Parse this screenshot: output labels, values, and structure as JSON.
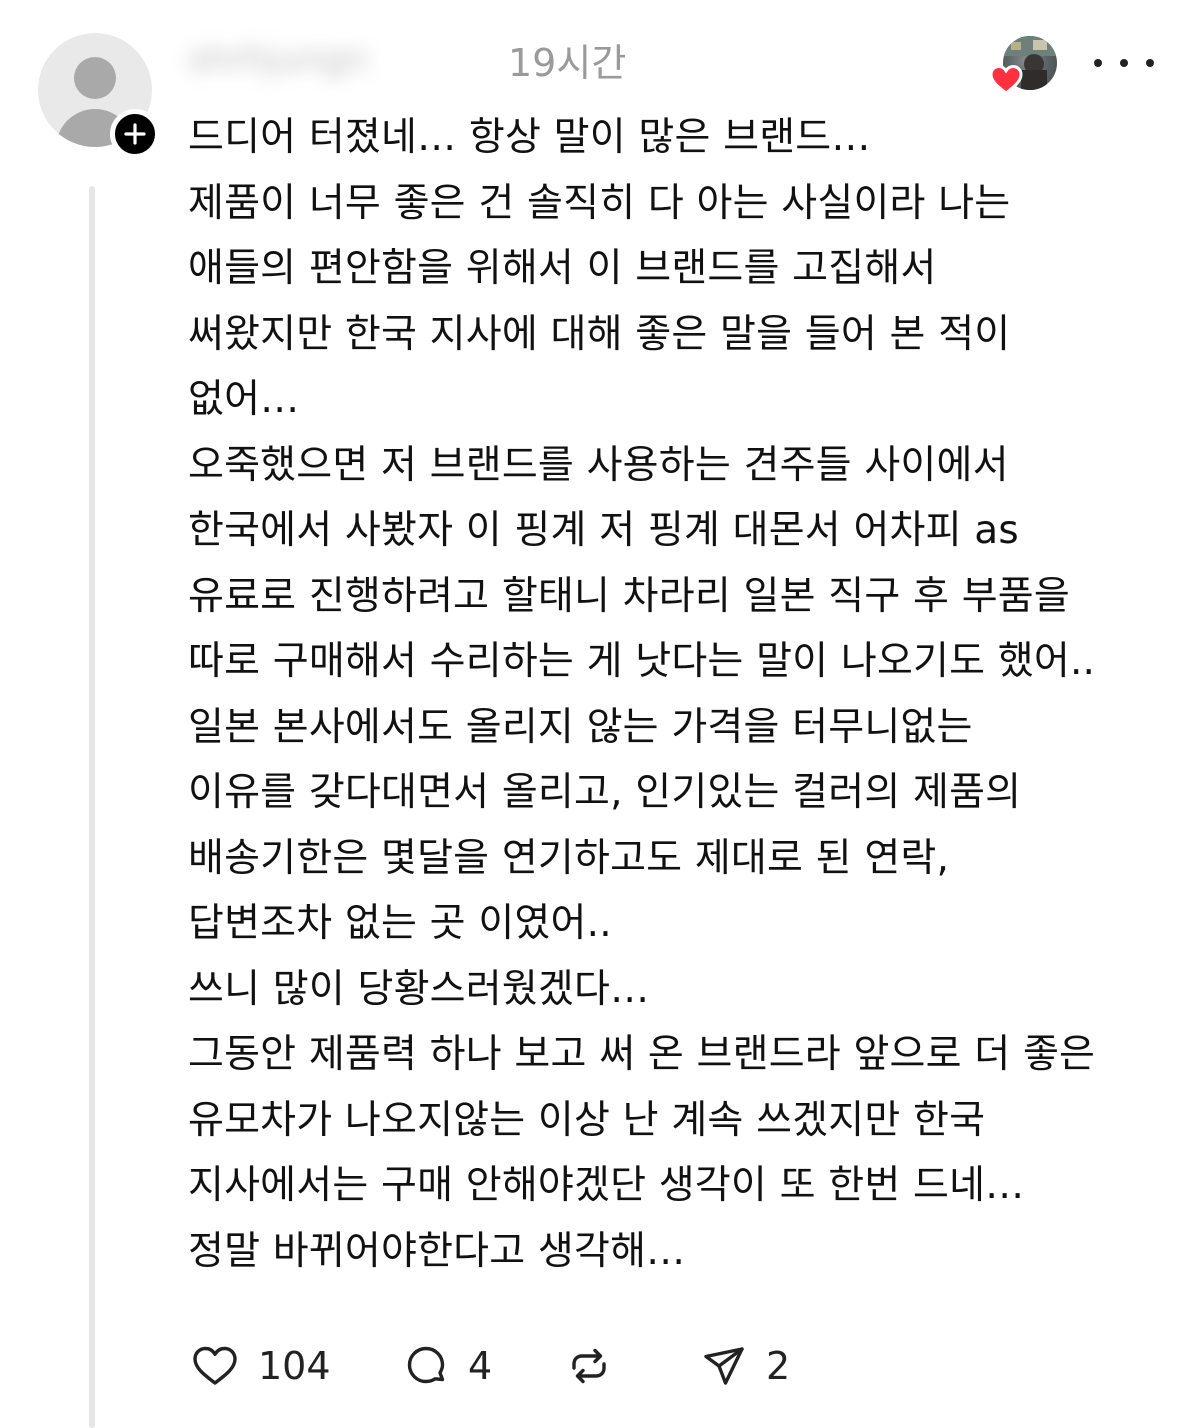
{
  "post": {
    "username": "shrhjungn",
    "timestamp": "19시간",
    "body_lines": [
      "드디어 터졌네… 항상 말이 많은 브랜드…",
      "제품이 너무 좋은 건 솔직히 다 아는 사실이라 나는",
      "애들의 편안함을 위해서 이 브랜드를 고집해서",
      "써왔지만 한국 지사에 대해 좋은 말을 들어 본 적이",
      "없어…",
      "오죽했으면 저 브랜드를 사용하는 견주들 사이에서",
      "한국에서 사봤자 이 핑계 저 핑계 대몬서 어차피 as",
      "유료로 진행하려고 할태니 차라리 일본 직구 후 부품을",
      "따로 구매해서 수리하는 게 낫다는 말이 나오기도 했어..",
      "일본 본사에서도 올리지 않는 가격을 터무니없는",
      "이유를 갖다대면서 올리고, 인기있는 컬러의 제품의",
      "배송기한은 몇달을 연기하고도 제대로 된 연락,",
      "답변조차 없는 곳 이였어..",
      "쓰니 많이 당황스러웠겠다…",
      "그동안 제품력 하나 보고 써 온 브랜드라 앞으로 더 좋은",
      "유모차가 나오지않는 이상 난 계속 쓰겠지만 한국",
      "지사에서는 구매 안해야겠단 생각이 또 한번 드네…",
      "정말 바뀌어야한다고 생각해…"
    ]
  },
  "actions": {
    "like_count": "104",
    "comment_count": "4",
    "share_count": "2"
  },
  "icons": {
    "avatar": "default-avatar-icon",
    "follow": "plus-icon",
    "liked_by": "heart-icon",
    "more": "more-dots-icon",
    "like": "heart-outline-icon",
    "comment": "comment-bubble-icon",
    "repost": "repost-icon",
    "share": "send-icon"
  },
  "colors": {
    "text": "#111111",
    "muted": "#9a9a9a",
    "heart_red": "#ff3040",
    "thread_line": "#e6e6e6"
  }
}
